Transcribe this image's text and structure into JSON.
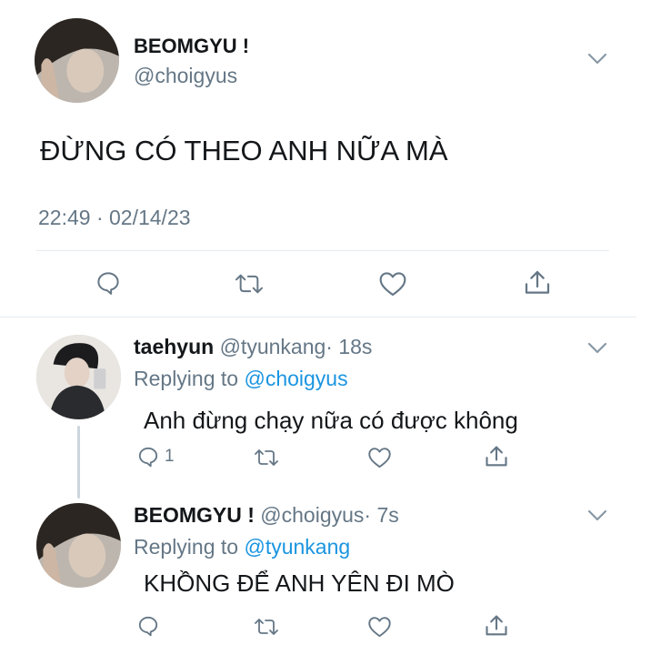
{
  "main_tweet": {
    "display_name": "BEOMGYU !",
    "handle": "@choigyus",
    "text": "ĐỪNG CÓ THEO ANH NỮA MÀ",
    "timestamp": "22:49 · 02/14/23",
    "actions": [
      "reply-icon",
      "retweet-icon",
      "like-icon",
      "share-icon"
    ]
  },
  "replies": [
    {
      "display_name": "taehyun",
      "handle": "@tyunkang",
      "time": "· 18s",
      "replying_label": "Replying to",
      "replying_to": "@choigyus",
      "text": "Anh đừng chạy nữa có được không",
      "reply_count": "1"
    },
    {
      "display_name": "BEOMGYU !",
      "handle": "@choigyus",
      "time": "· 7s",
      "replying_label": "Replying to",
      "replying_to": "@tyunkang",
      "text": "KHỒNG ĐỂ ANH YÊN ĐI MÒ"
    }
  ],
  "colors": {
    "icon_gray": "#657786",
    "link_blue": "#1b95e0",
    "divider": "#e6ecf0"
  }
}
